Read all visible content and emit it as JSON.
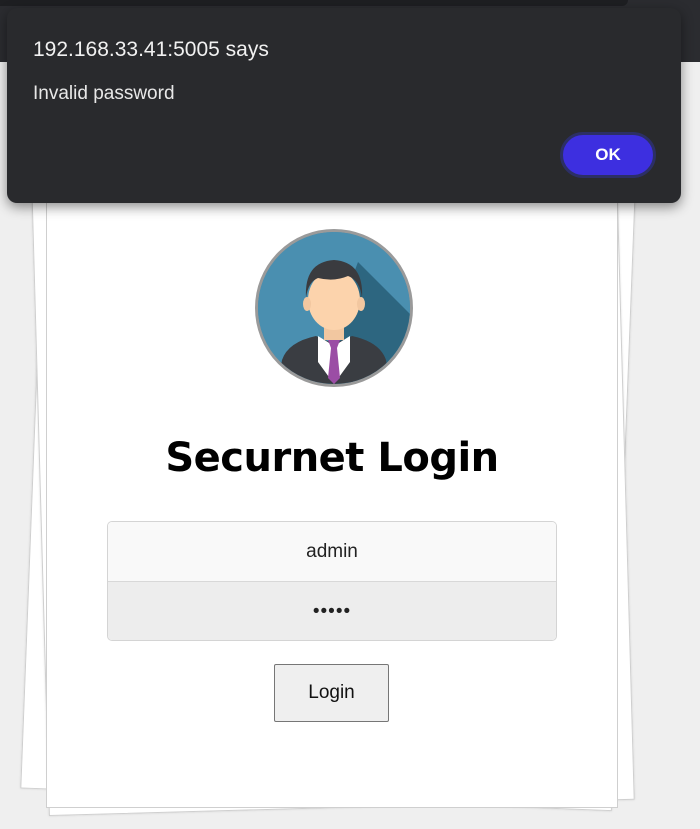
{
  "dialog": {
    "title": "192.168.33.41:5005 says",
    "message": "Invalid password",
    "ok_label": "OK",
    "ok_color": "#3d2fe0"
  },
  "login": {
    "title": "Securnet Login",
    "username_value": "admin",
    "password_value": "•••••",
    "button_label": "Login",
    "avatar_icon": "user-avatar-icon"
  }
}
